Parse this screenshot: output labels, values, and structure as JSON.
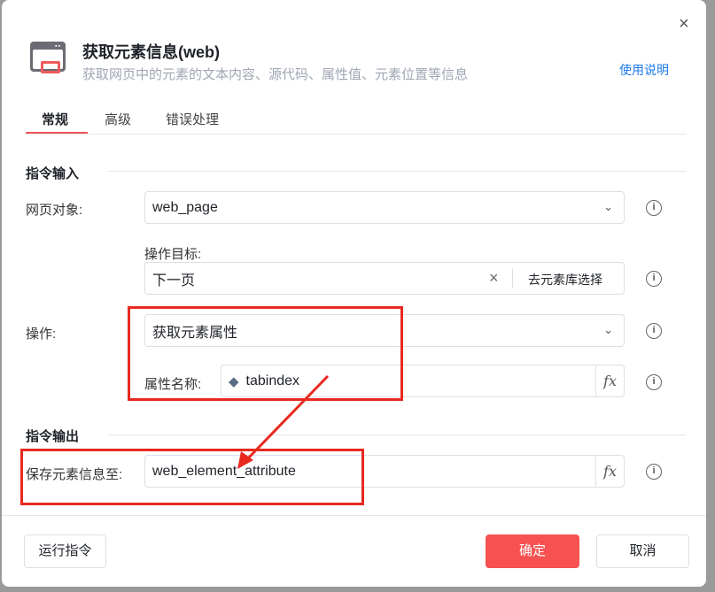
{
  "header": {
    "title": "获取元素信息(web)",
    "subtitle": "获取网页中的元素的文本内容、源代码、属性值、元素位置等信息",
    "help_link": "使用说明",
    "close": "×"
  },
  "tabs": [
    {
      "label": "常规"
    },
    {
      "label": "高级"
    },
    {
      "label": "错误处理"
    }
  ],
  "input_section": {
    "title": "指令输入",
    "web_page": {
      "label": "网页对象:",
      "value": "web_page"
    },
    "target": {
      "label": "操作目标:",
      "value": "下一页",
      "clear": "×",
      "picker": "去元素库选择"
    },
    "operation": {
      "label": "操作:",
      "value": "获取元素属性"
    },
    "attr_name": {
      "label": "属性名称:",
      "value": "tabindex"
    }
  },
  "output_section": {
    "title": "指令输出",
    "save_to": {
      "label": "保存元素信息至:",
      "value": "web_element_attribute"
    }
  },
  "footer": {
    "run": "运行指令",
    "ok": "确定",
    "cancel": "取消"
  },
  "icons": {
    "fx": "fx",
    "info": "i",
    "chevron": "⌄"
  },
  "colors": {
    "accent": "#f25555",
    "link": "#1e7ae8",
    "annotation": "#e8291f"
  }
}
